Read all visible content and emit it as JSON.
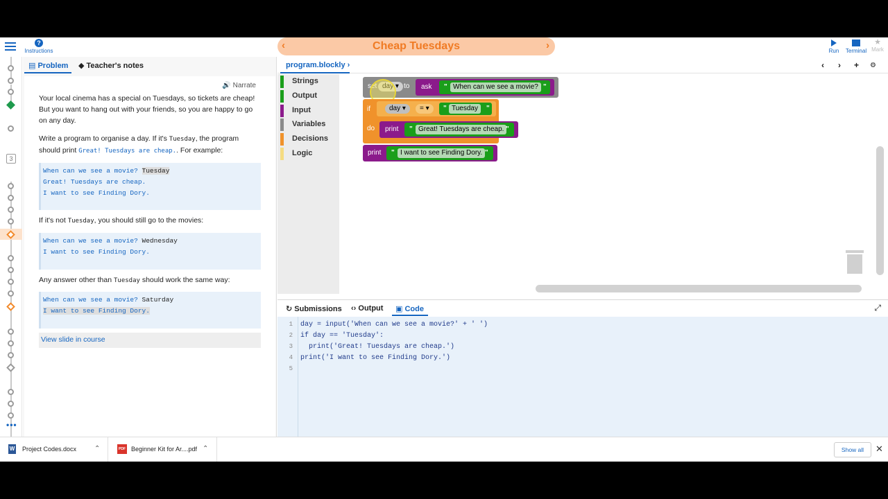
{
  "toolbar": {
    "instructions_label": "Instructions",
    "title": "Cheap Tuesdays",
    "prev_arrow": "‹",
    "next_arrow": "›",
    "run_label": "Run",
    "terminal_label": "Terminal",
    "mark_label": "Mark"
  },
  "rail": {
    "step_number": "3",
    "more": "•••"
  },
  "left_panel": {
    "tabs": [
      {
        "label": "Problem",
        "active": true
      },
      {
        "label": "Teacher's notes",
        "active": false
      }
    ],
    "narrate": "Narrate",
    "para1": "Your local cinema has a special on Tuesdays, so tickets are cheap! But you want to hang out with your friends, so you are happy to go on any day.",
    "para2_a": "Write a program to organise a day. If it's ",
    "para2_code1": "Tuesday",
    "para2_b": ", the program should print ",
    "para2_code2": "Great! Tuesdays are cheap.",
    "para2_c": ". For example:",
    "example1": {
      "prompt": "When can we see a movie? ",
      "input": "Tuesday",
      "line2": "Great! Tuesdays are cheap.",
      "line3": "I want to see Finding Dory."
    },
    "para3_a": "If it's not ",
    "para3_code": "Tuesday",
    "para3_b": ", you should still go to the movies:",
    "example2": {
      "prompt": "When can we see a movie? ",
      "input": "Wednesday",
      "line2": "I want to see Finding Dory."
    },
    "para4_a": "Any answer other than ",
    "para4_code": "Tuesday",
    "para4_b": " should work the same way:",
    "example3": {
      "prompt": "When can we see a movie? ",
      "input": "Saturday",
      "line2": "I want to see Finding Dory."
    },
    "slide_link": "View slide in course"
  },
  "editor": {
    "file_tab": "program.blockly",
    "file_arrow": "›",
    "controls": [
      "‹",
      "›",
      "+",
      "⚙"
    ],
    "categories": [
      {
        "label": "Strings",
        "color": "#1a9e1a"
      },
      {
        "label": "Output",
        "color": "#1a9e1a"
      },
      {
        "label": "Input",
        "color": "#8b1a8b"
      },
      {
        "label": "Variables",
        "color": "#8a8a8a"
      },
      {
        "label": "Decisions",
        "color": "#f0922b"
      },
      {
        "label": "Logic",
        "color": "#f5dc82"
      }
    ],
    "blocks": {
      "set_label": "set",
      "to_label": "to",
      "ask_label": "ask",
      "ask_text": "When can we see a movie?",
      "var_name": "day",
      "if_label": "if",
      "do_label": "do",
      "eq_op": "=",
      "compare_text": "Tuesday",
      "print_label": "print",
      "print1_text": "Great! Tuesdays are cheap.",
      "print2_text": "I want to see Finding Dory.",
      "quote": "\""
    }
  },
  "bottom_panel": {
    "tabs": [
      {
        "label": "Submissions",
        "active": false
      },
      {
        "label": "Output",
        "active": false
      },
      {
        "label": "Code",
        "active": true
      }
    ],
    "code_lines": [
      {
        "num": "1",
        "text": "day = input('When can we see a movie?' + ' ')"
      },
      {
        "num": "2",
        "text": "if day == 'Tuesday':"
      },
      {
        "num": "3",
        "text": "  print('Great! Tuesdays are cheap.')"
      },
      {
        "num": "4",
        "text": "print('I want to see Finding Dory.')"
      },
      {
        "num": "5",
        "text": ""
      }
    ]
  },
  "downloads": {
    "items": [
      {
        "name": "Project Codes.docx",
        "icon": "W",
        "color": "#2b5797"
      },
      {
        "name": "Beginner Kit for Ar....pdf",
        "icon": "PDF",
        "color": "#d9342b"
      }
    ],
    "show_all": "Show all",
    "close": "✕"
  }
}
